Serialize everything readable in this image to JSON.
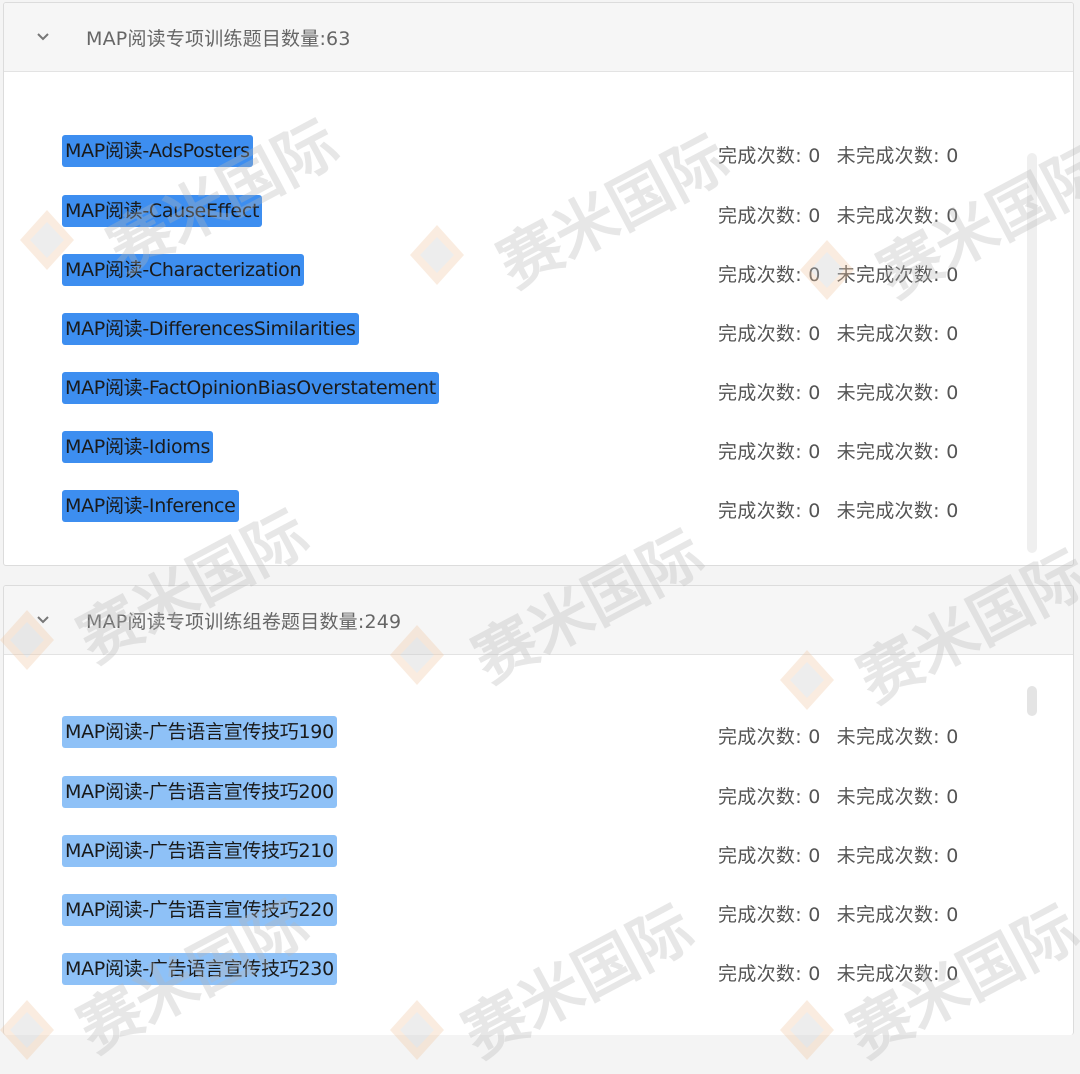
{
  "panels": [
    {
      "title": "MAP阅读专项训练题目数量:63",
      "items": [
        {
          "label": "MAP阅读-AdsPosters",
          "completed_label": "完成次数:",
          "completed": "0",
          "incomplete_label": "未完成次数:",
          "incomplete": "0"
        },
        {
          "label": "MAP阅读-CauseEffect",
          "completed_label": "完成次数:",
          "completed": "0",
          "incomplete_label": "未完成次数:",
          "incomplete": "0"
        },
        {
          "label": "MAP阅读-Characterization",
          "completed_label": "完成次数:",
          "completed": "0",
          "incomplete_label": "未完成次数:",
          "incomplete": "0"
        },
        {
          "label": "MAP阅读-DifferencesSimilarities",
          "completed_label": "完成次数:",
          "completed": "0",
          "incomplete_label": "未完成次数:",
          "incomplete": "0"
        },
        {
          "label": "MAP阅读-FactOpinionBiasOverstatement",
          "completed_label": "完成次数:",
          "completed": "0",
          "incomplete_label": "未完成次数:",
          "incomplete": "0"
        },
        {
          "label": "MAP阅读-Idioms",
          "completed_label": "完成次数:",
          "completed": "0",
          "incomplete_label": "未完成次数:",
          "incomplete": "0"
        },
        {
          "label": "MAP阅读-Inference",
          "completed_label": "完成次数:",
          "completed": "0",
          "incomplete_label": "未完成次数:",
          "incomplete": "0"
        }
      ]
    },
    {
      "title": "MAP阅读专项训练组卷题目数量:249",
      "items": [
        {
          "label": "MAP阅读-广告语言宣传技巧190",
          "completed_label": "完成次数:",
          "completed": "0",
          "incomplete_label": "未完成次数:",
          "incomplete": "0"
        },
        {
          "label": "MAP阅读-广告语言宣传技巧200",
          "completed_label": "完成次数:",
          "completed": "0",
          "incomplete_label": "未完成次数:",
          "incomplete": "0"
        },
        {
          "label": "MAP阅读-广告语言宣传技巧210",
          "completed_label": "完成次数:",
          "completed": "0",
          "incomplete_label": "未完成次数:",
          "incomplete": "0"
        },
        {
          "label": "MAP阅读-广告语言宣传技巧220",
          "completed_label": "完成次数:",
          "completed": "0",
          "incomplete_label": "未完成次数:",
          "incomplete": "0"
        },
        {
          "label": "MAP阅读-广告语言宣传技巧230",
          "completed_label": "完成次数:",
          "completed": "0",
          "incomplete_label": "未完成次数:",
          "incomplete": "0"
        }
      ]
    }
  ],
  "watermark": {
    "text": "赛米国际"
  },
  "colors": {
    "tag_dark": "#3d8ef0",
    "tag_light": "#8ec1f7",
    "header_bg": "#f6f6f6"
  },
  "icons": {
    "panel_toggle": "chevron-down-icon",
    "watermark_logo": "logo-mark-icon"
  }
}
